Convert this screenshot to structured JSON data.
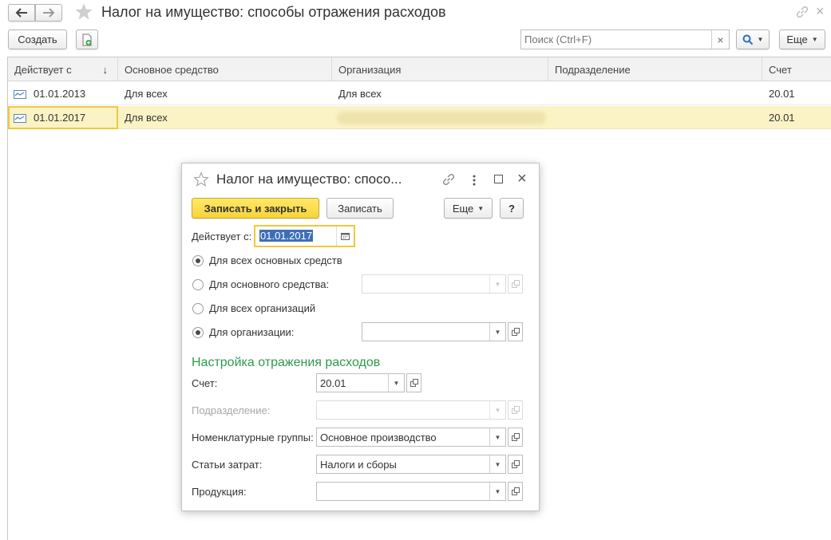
{
  "window": {
    "title": "Налог на имущество: способы отражения расходов"
  },
  "toolbar": {
    "create_label": "Создать",
    "search_placeholder": "Поиск (Ctrl+F)",
    "more_label": "Еще",
    "clear_symbol": "×"
  },
  "table": {
    "columns": [
      "Действует с",
      "Основное средство",
      "Организация",
      "Подразделение",
      "Счет"
    ],
    "sort_arrow": "↓",
    "rows": [
      {
        "date": "01.01.2013",
        "asset": "Для всех",
        "org": "Для всех",
        "division": "",
        "account": "20.01"
      },
      {
        "date": "01.01.2017",
        "asset": "Для всех",
        "org": "",
        "division": "",
        "account": "20.01"
      }
    ]
  },
  "dialog": {
    "title": "Налог на имущество: спосо...",
    "save_close_label": "Записать и закрыть",
    "save_label": "Записать",
    "more_label": "Еще",
    "help_label": "?",
    "valid_from_label": "Действует с:",
    "valid_from_value": "01.01.2017",
    "radio_all_assets": "Для всех основных средств",
    "radio_asset": "Для основного средства:",
    "radio_all_orgs": "Для всех организаций",
    "radio_org": "Для организации:",
    "section_title": "Настройка отражения расходов",
    "account_label": "Счет:",
    "account_value": "20.01",
    "division_label": "Подразделение:",
    "nomenclature_label": "Номенклатурные группы:",
    "nomenclature_value": "Основное производство",
    "cost_items_label": "Статьи затрат:",
    "cost_items_value": "Налоги и сборы",
    "products_label": "Продукция:"
  },
  "colors": {
    "accent_yellow": "#fbe64b",
    "selected_row": "#fbf3c5",
    "section_green": "#2e9a4f"
  }
}
